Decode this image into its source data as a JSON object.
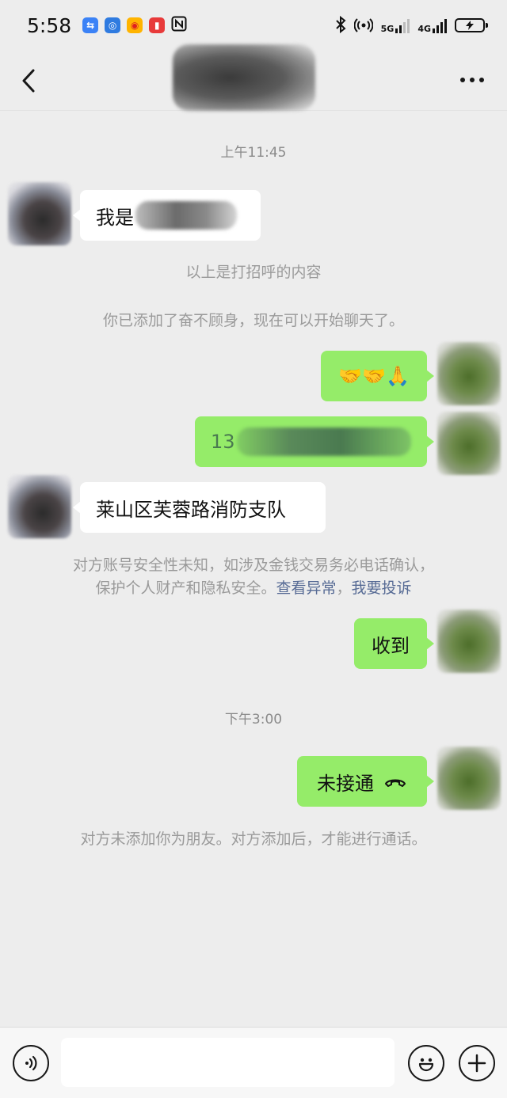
{
  "status_bar": {
    "time": "5:58",
    "network_5g": "5G",
    "network_4g": "4G",
    "sim_slot": "1",
    "icons": [
      "usb-icon",
      "bulb-app-icon",
      "weibo-icon",
      "app-badge-icon",
      "nfc-icon",
      "bluetooth-icon",
      "hotspot-icon",
      "battery-charging-icon"
    ]
  },
  "header": {
    "title": "",
    "back_icon": "chevron-left-icon",
    "more_icon": "more-dots-icon"
  },
  "messages": {
    "ts1": "上午11:45",
    "m1_visible_prefix": "我是",
    "sys_greeting": "以上是打招呼的内容",
    "sys_added": "你已添加了奋不顾身，现在可以开始聊天了。",
    "m2_emojis": "🤝🤝🙏",
    "m3_visible_prefix": "13",
    "m4_text": "莱山区芙蓉路消防支队",
    "warn_line1": "对方账号安全性未知，如涉及金钱交易务必电话确认，",
    "warn_line2_prefix": "保护个人财产和隐私安全。",
    "warn_link1": "查看异常",
    "warn_separator": "，",
    "warn_link2": "我要投诉",
    "m5_text": "收到",
    "ts2": "下午3:00",
    "m6_text": "未接通",
    "sys_not_friend": "对方未添加你为朋友。对方添加后，才能进行通话。"
  },
  "input_bar": {
    "placeholder": "",
    "voice_icon": "voice-icon",
    "emoji_icon": "emoji-icon",
    "plus_icon": "plus-icon"
  },
  "colors": {
    "background": "#ededed",
    "bubble_mine": "#95ec69",
    "bubble_theirs": "#ffffff",
    "link": "#576b95",
    "system_text": "#9a9a9a"
  }
}
